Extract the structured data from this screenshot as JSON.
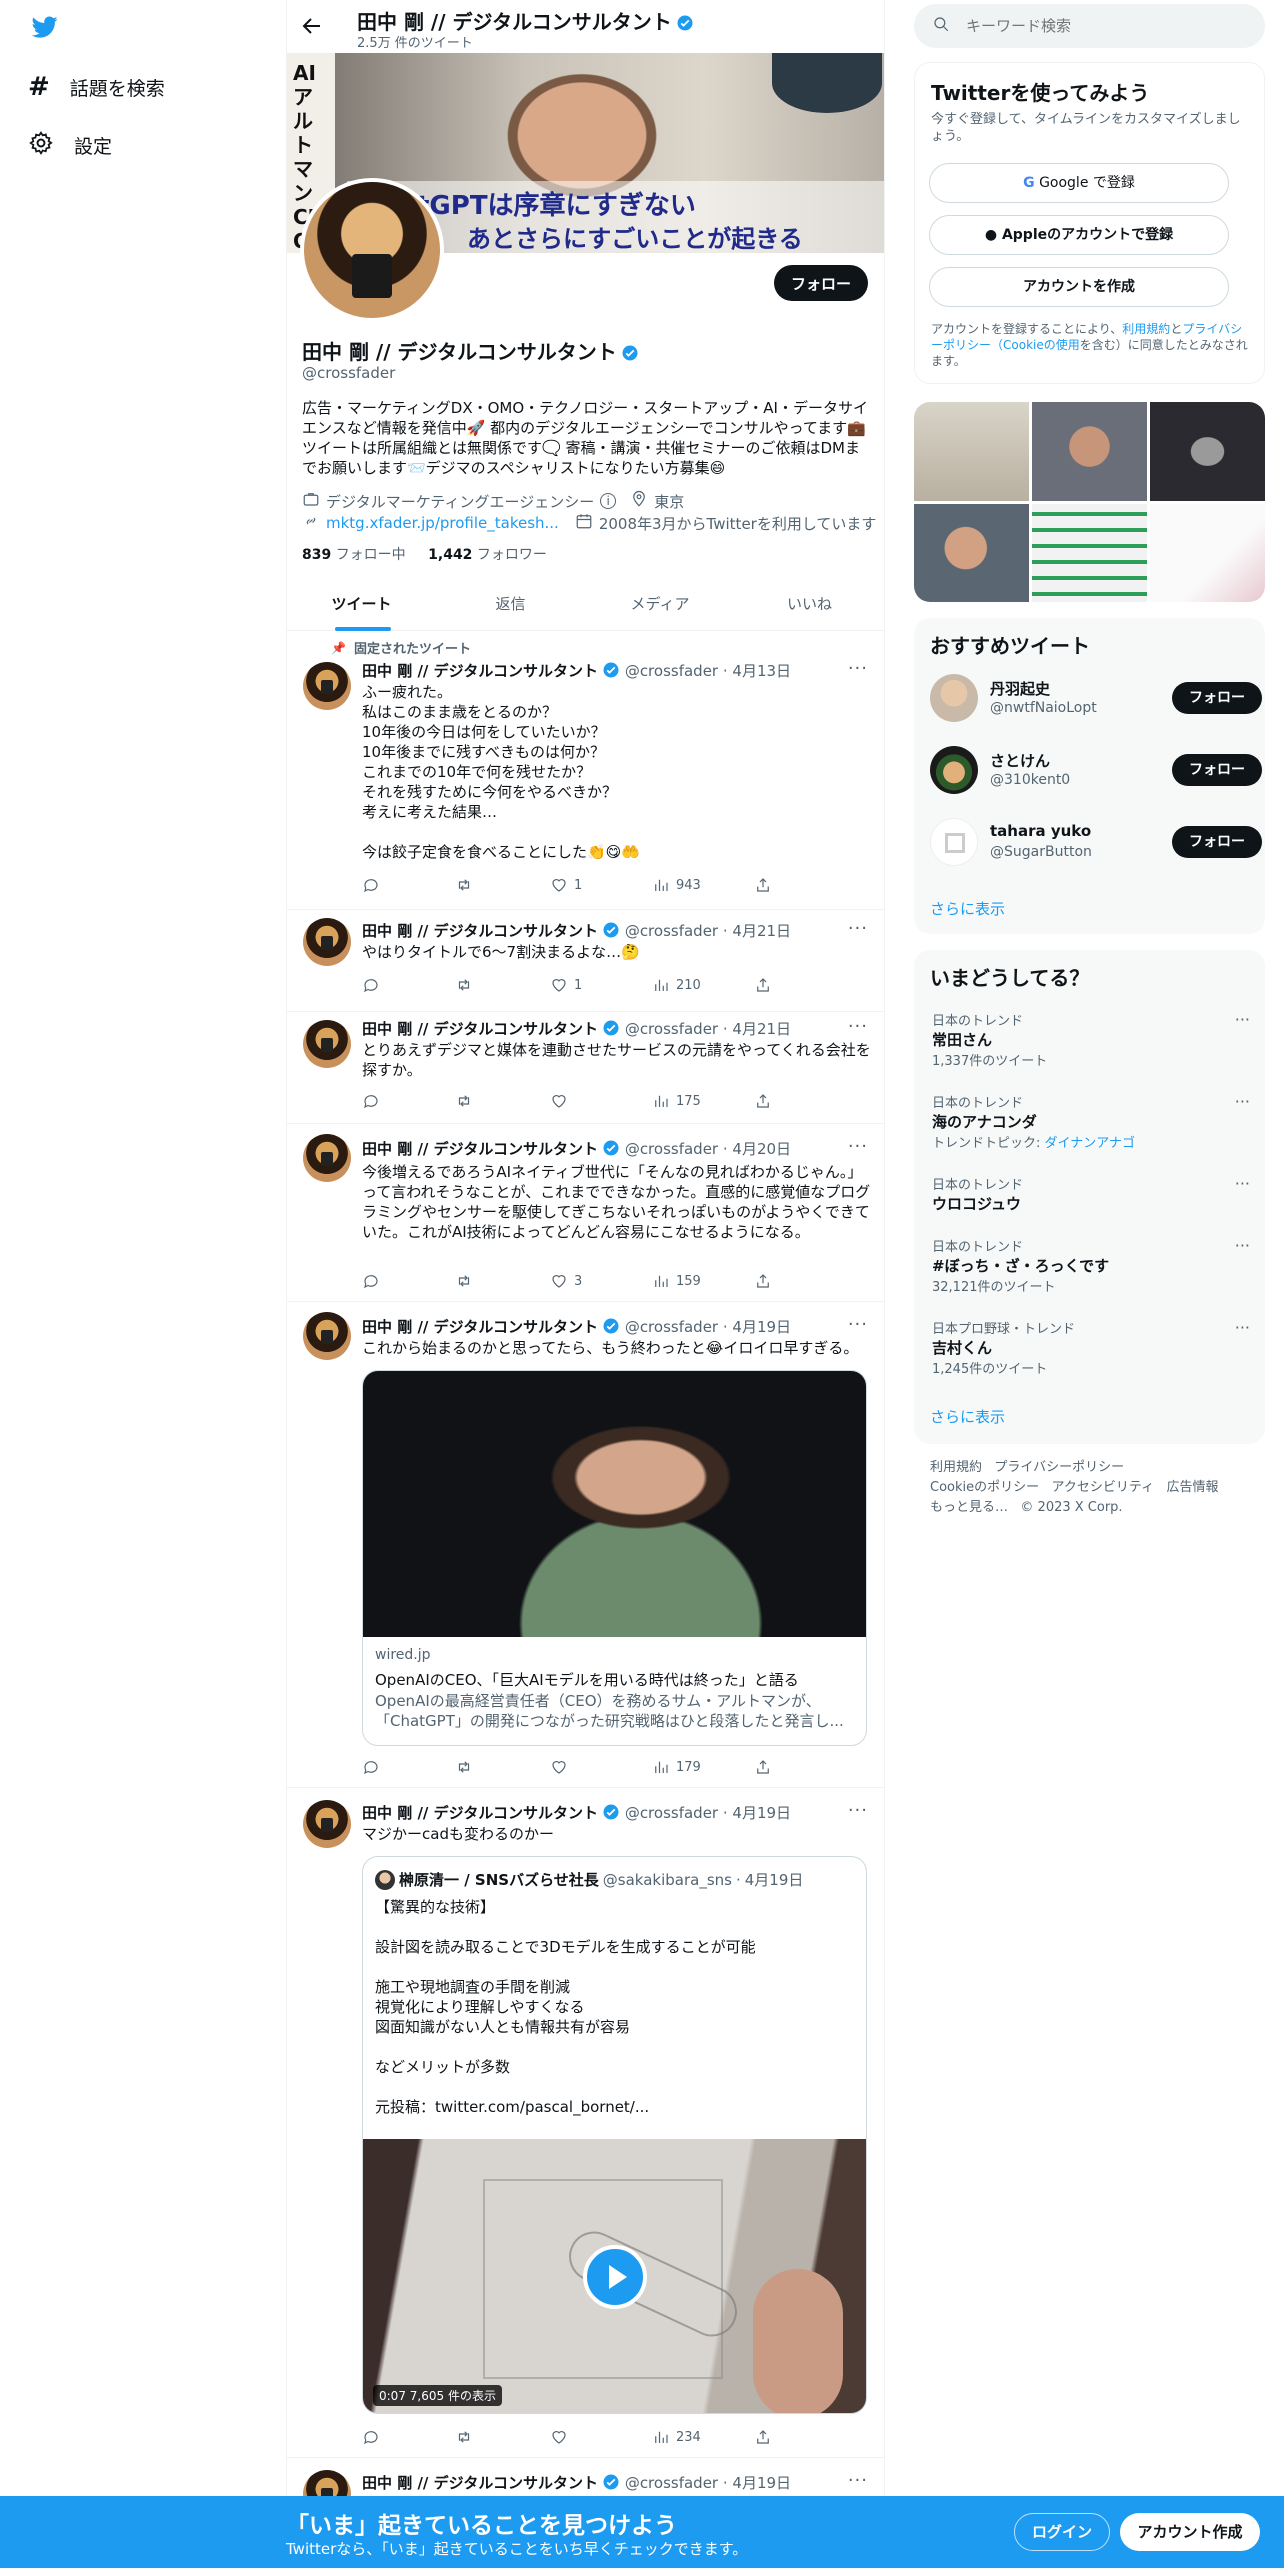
{
  "left_nav": {
    "explore_label": "話題を検索",
    "settings_label": "設定"
  },
  "header": {
    "name": "田中 剛 // デジタルコンサルタント",
    "tweet_count": "2.5万 件のツイート"
  },
  "banner": {
    "caption_line1": "tGPTは序章にすぎない",
    "caption_line2": "あとさらにすごいことが起きる",
    "side_text": "AI アルトマン CEO"
  },
  "profile": {
    "follow_label": "フォロー",
    "name": "田中 剛 // デジタルコンサルタント",
    "handle": "@crossfader",
    "bio": "広告・マーケティングDX・OMO・テクノロジー・スタートアップ・AI・データサイエンスなど情報を発信中🚀 都内のデジタルエージェンシーでコンサルやってます💼 ツイートは所属組織とは無関係です🗨️ 寄稿・講演・共催セミナーのご依頼はDMまでお願いします📨デジマのスペシャリストになりたい方募集😄",
    "category": "デジタルマーケティングエージェンシー",
    "location": "東京",
    "link": "mktg.xfader.jp/profile_takesh...",
    "joined": "2008年3月からTwitterを利用しています",
    "following_count": "839",
    "following_label": "フォロー中",
    "followers_count": "1,442",
    "followers_label": "フォロワー"
  },
  "tabs": [
    "ツイート",
    "返信",
    "メディア",
    "いいね"
  ],
  "pinned_label": "固定されたツイート",
  "tweets": [
    {
      "name": "田中 剛 // デジタルコンサルタント",
      "handle": "@crossfader",
      "date": "4月13日",
      "body": "ふー疲れた。\n私はこのまま歳をとるのか？\n10年後の今日は何をしていたいか？\n10年後までに残すべきものは何か？\nこれまでの10年で何を残せたか？\nそれを残すために今何をやるべきか？\n考えに考えた結果…\n\n今は餃子定食を食べることにした👏😋🤲",
      "likes": "1",
      "views": "943"
    },
    {
      "name": "田中 剛 // デジタルコンサルタント",
      "handle": "@crossfader",
      "date": "4月21日",
      "body": "やはりタイトルで6〜7割決まるよな…🤔",
      "likes": "1",
      "views": "210"
    },
    {
      "name": "田中 剛 // デジタルコンサルタント",
      "handle": "@crossfader",
      "date": "4月21日",
      "body": "とりあえずデジマと媒体を連動させたサービスの元請をやってくれる会社を探すか。",
      "likes": "",
      "views": "175"
    },
    {
      "name": "田中 剛 // デジタルコンサルタント",
      "handle": "@crossfader",
      "date": "4月20日",
      "body": "今後増えるであろうAIネイティブ世代に「そんなの見ればわかるじゃん。」って言われそうなことが、これまでできなかった。直感的に感覚値なプログラミングやセンサーを駆使してぎこちないそれっぽいものがようやくできていた。これがAI技術によってどんどん容易にこなせるようになる。",
      "likes": "3",
      "views": "159"
    },
    {
      "name": "田中 剛 // デジタルコンサルタント",
      "handle": "@crossfader",
      "date": "4月19日",
      "body": "これから始まるのかと思ってたら、もう終わったと😂イロイロ早すぎる。",
      "likes": "",
      "views": "179",
      "card": {
        "domain": "wired.jp",
        "title": "OpenAIのCEO、「巨大AIモデルを用いる時代は終った」と語る",
        "desc": "OpenAIの最高経営責任者（CEO）を務めるサム・アルトマンが、「ChatGPT」の開発につながった研究戦略はひと段落したと発言し..."
      }
    },
    {
      "name": "田中 剛 // デジタルコンサルタント",
      "handle": "@crossfader",
      "date": "4月19日",
      "body": "マジかーcadも変わるのかー",
      "likes": "",
      "views": "234",
      "quote": {
        "name": "榊原清一 / SNSバズらせ社長",
        "handle": "@sakakibara_sns",
        "date": "4月19日",
        "body": "【驚異的な技術】\n\n設計図を読み取ることで3Dモデルを生成することが可能\n\n施工や現地調査の手間を削減\n視覚化により理解しやすくなる\n図面知識がない人とも情報共有が容易\n\nなどメリットが多数\n\n元投稿：twitter.com/pascal_bornet/...",
        "video_time": "0:07",
        "video_views": "7,605 件の表示"
      }
    },
    {
      "name": "田中 剛 // デジタルコンサルタント",
      "handle": "@crossfader",
      "date": "4月19日"
    }
  ],
  "search": {
    "placeholder": "キーワード検索"
  },
  "signup": {
    "title": "Twitterを使ってみよう",
    "subtitle": "今すぐ登録して、タイムラインをカスタマイズしましょう。",
    "google": "Google で登録",
    "apple": "Appleのアカウントで登録",
    "create": "アカウントを作成",
    "terms_pre": "アカウントを登録することにより、",
    "terms_link1": "利用規約",
    "terms_mid": "と",
    "terms_link2": "プライバシーポリシー（Cookieの使用",
    "terms_post": "を含む）に同意したとみなされます。"
  },
  "recommend": {
    "title": "おすすめツイート",
    "users": [
      {
        "name": "丹羽起史",
        "handle": "@nwtfNaioLopt",
        "follow": "フォロー"
      },
      {
        "name": "さとけん",
        "handle": "@310kent0",
        "follow": "フォロー"
      },
      {
        "name": "tahara yuko",
        "handle": "@SugarButton",
        "follow": "フォロー"
      }
    ],
    "more": "さらに表示"
  },
  "trends": {
    "title": "いまどうしてる？",
    "items": [
      {
        "cat": "日本のトレンド",
        "name": "常田さん",
        "cnt": "1,337件のツイート"
      },
      {
        "cat": "日本のトレンド",
        "name": "海のアナコンダ",
        "cnt": "トレンドトピック: ",
        "link": "ダイナンアナゴ"
      },
      {
        "cat": "日本のトレンド",
        "name": "ウロコジュウ",
        "cnt": ""
      },
      {
        "cat": "日本のトレンド",
        "name": "#ぼっち・ざ・ろっくです",
        "cnt": "32,121件のツイート"
      },
      {
        "cat": "日本プロ野球・トレンド",
        "name": "吉村くん",
        "cnt": "1,245件のツイート"
      }
    ],
    "more": "さらに表示"
  },
  "footer": {
    "terms": "利用規約",
    "privacy": "プライバシーポリシー",
    "cookie": "Cookieのポリシー",
    "access": "アクセシビリティ",
    "ads": "広告情報",
    "more": "もっと見る…",
    "copyright": "© 2023 X Corp."
  },
  "bottom_bar": {
    "title": "「いま」起きていることを見つけよう",
    "subtitle": "Twitterなら、「いま」起きていることをいち早くチェックできます。",
    "login": "ログイン",
    "signup": "アカウント作成"
  },
  "colors": {
    "accent": "#1d9bf0",
    "dark": "#0f1419"
  }
}
